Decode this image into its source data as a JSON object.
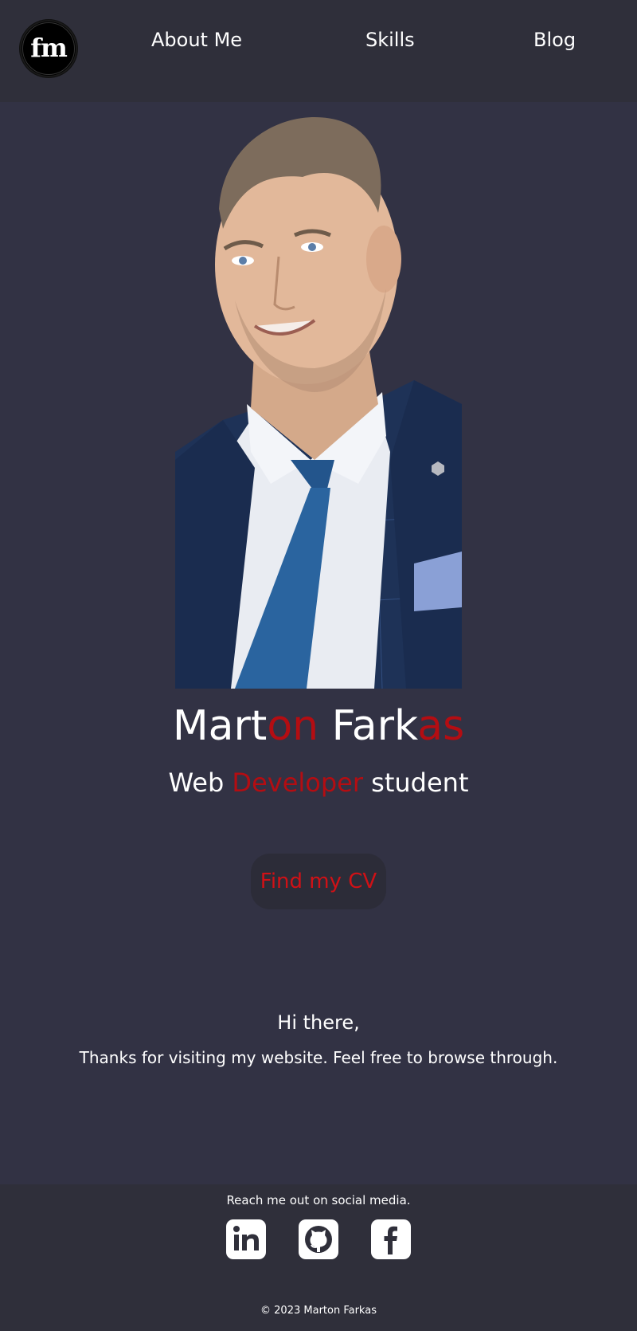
{
  "header": {
    "logo_text": "fm",
    "nav": [
      {
        "label": "About Me"
      },
      {
        "label": "Skills"
      },
      {
        "label": "Blog"
      }
    ]
  },
  "hero": {
    "name_parts": [
      "Mart",
      "on",
      " Fark",
      "as"
    ],
    "subtitle_parts": [
      "Web ",
      "Developer",
      " student"
    ],
    "cv_button": "Find my CV"
  },
  "greeting": {
    "title": "Hi there,",
    "message": "Thanks for visiting my website. Feel free to browse through."
  },
  "footer": {
    "social_text": "Reach me out on social media.",
    "icons": [
      "linkedin-icon",
      "github-icon",
      "facebook-icon"
    ],
    "copyright": "© 2023 Marton Farkas"
  },
  "colors": {
    "background": "#323244",
    "header": "#2f2f3a",
    "accent": "#b40d12",
    "button_text": "#d01116"
  }
}
